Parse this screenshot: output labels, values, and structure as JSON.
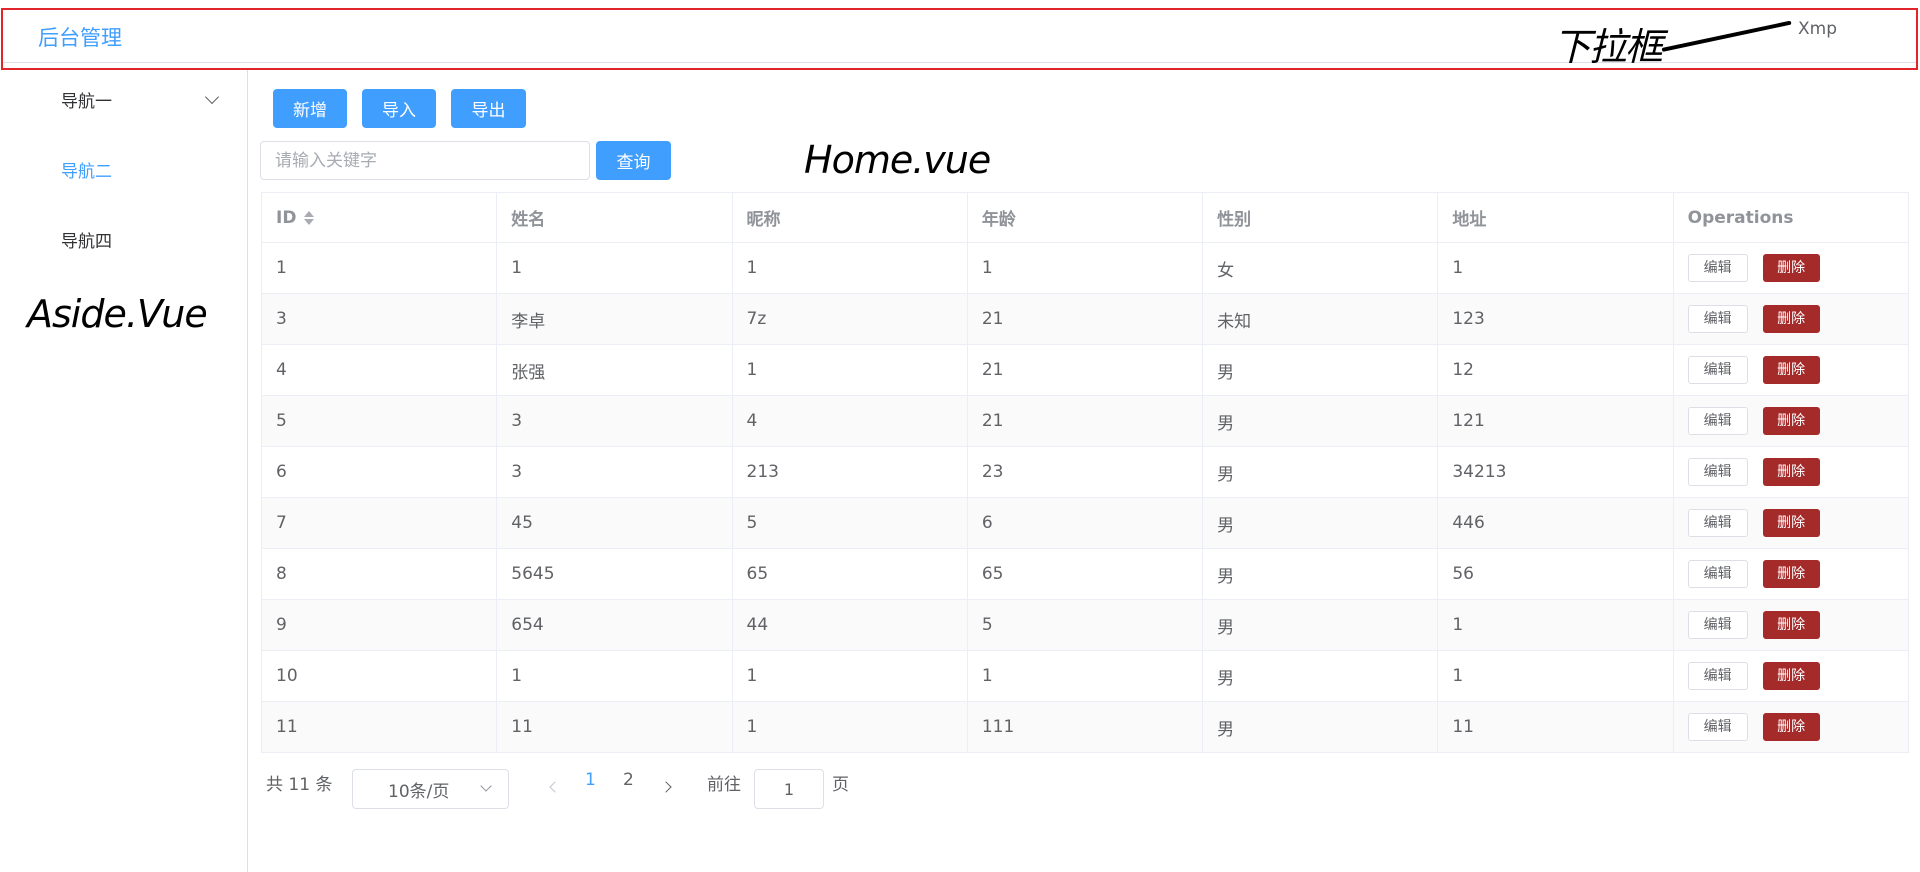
{
  "header": {
    "brand": "后台管理",
    "user": "Xmp"
  },
  "annotations": {
    "dropdown": "下拉框",
    "home": "Home.vue",
    "aside": "Aside.Vue"
  },
  "aside": {
    "items": [
      {
        "label": "导航一",
        "active": false
      },
      {
        "label": "导航二",
        "active": true
      },
      {
        "label": "导航四",
        "active": false
      }
    ]
  },
  "toolbar": {
    "add_label": "新增",
    "import_label": "导入",
    "export_label": "导出"
  },
  "search": {
    "placeholder": "请输入关键字",
    "button_label": "查询"
  },
  "table": {
    "columns": [
      "ID",
      "姓名",
      "昵称",
      "年龄",
      "性别",
      "地址",
      "Operations"
    ],
    "rows": [
      [
        "1",
        "1",
        "1",
        "1",
        "女",
        "1"
      ],
      [
        "3",
        "李卓",
        "7z",
        "21",
        "未知",
        "123"
      ],
      [
        "4",
        "张强",
        "1",
        "21",
        "男",
        "12"
      ],
      [
        "5",
        "3",
        "4",
        "21",
        "男",
        "121"
      ],
      [
        "6",
        "3",
        "213",
        "23",
        "男",
        "34213"
      ],
      [
        "7",
        "45",
        "5",
        "6",
        "男",
        "446"
      ],
      [
        "8",
        "5645",
        "65",
        "65",
        "男",
        "56"
      ],
      [
        "9",
        "654",
        "44",
        "5",
        "男",
        "1"
      ],
      [
        "10",
        "1",
        "1",
        "1",
        "男",
        "1"
      ],
      [
        "11",
        "11",
        "1",
        "111",
        "男",
        "11"
      ]
    ],
    "edit_label": "编辑",
    "delete_label": "删除"
  },
  "pagination": {
    "total_text": "共 11 条",
    "page_size": "10条/页",
    "pages": [
      "1",
      "2"
    ],
    "current_page": "1",
    "goto_label": "前往",
    "goto_value": "1",
    "page_suffix": "页"
  }
}
